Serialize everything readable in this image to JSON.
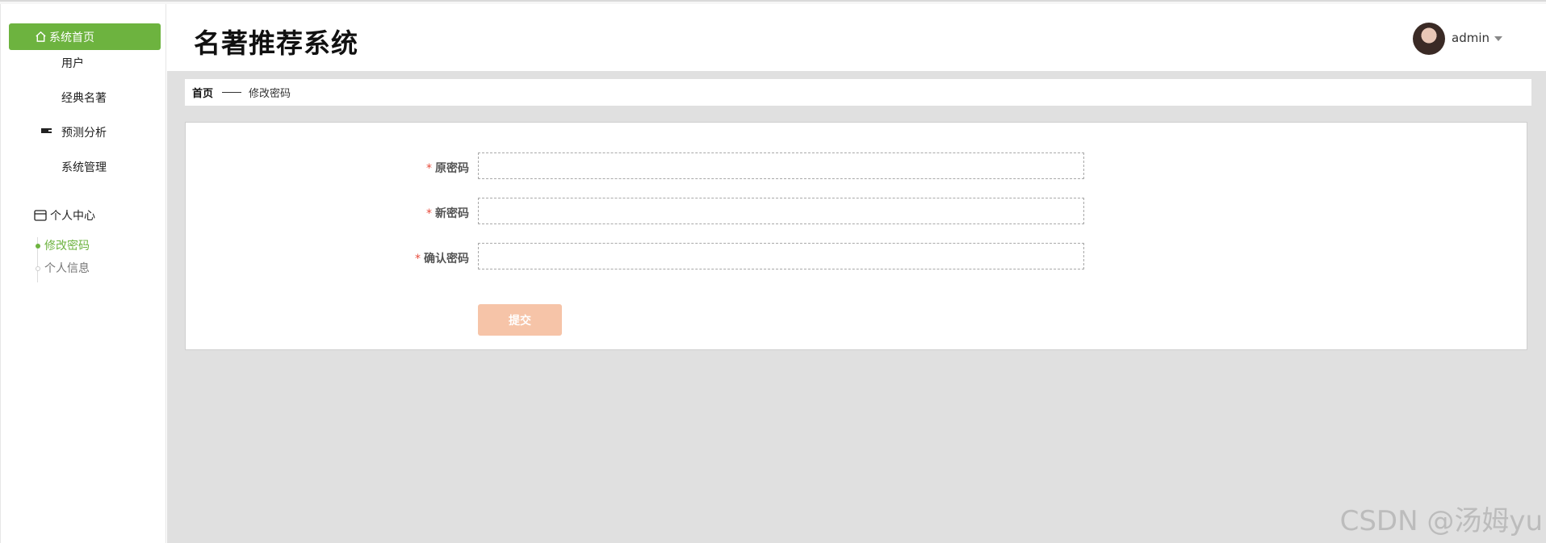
{
  "sidebar": {
    "home_label": "系统首页",
    "items": [
      {
        "label": "用户",
        "icon": "grid-icon"
      },
      {
        "label": "经典名著",
        "icon": "grid-icon"
      },
      {
        "label": "预测分析",
        "icon": "list-icon"
      },
      {
        "label": "系统管理",
        "icon": "grid-icon"
      }
    ],
    "personal_center": {
      "label": "个人中心",
      "icon": "card-icon",
      "children": [
        {
          "label": "修改密码",
          "active": true
        },
        {
          "label": "个人信息",
          "active": false
        }
      ]
    }
  },
  "header": {
    "title": "名著推荐系统",
    "username": "admin"
  },
  "breadcrumb": {
    "home": "首页",
    "current": "修改密码"
  },
  "form": {
    "required_mark": "*",
    "fields": [
      {
        "label": "原密码",
        "value": ""
      },
      {
        "label": "新密码",
        "value": ""
      },
      {
        "label": "确认密码",
        "value": ""
      }
    ],
    "submit_label": "提交"
  },
  "watermark": "CSDN @汤姆yu",
  "colors": {
    "accent": "#6db33f",
    "submit": "#f6c4a8",
    "required": "#e74c3c",
    "main_bg": "#e0e0e0"
  }
}
